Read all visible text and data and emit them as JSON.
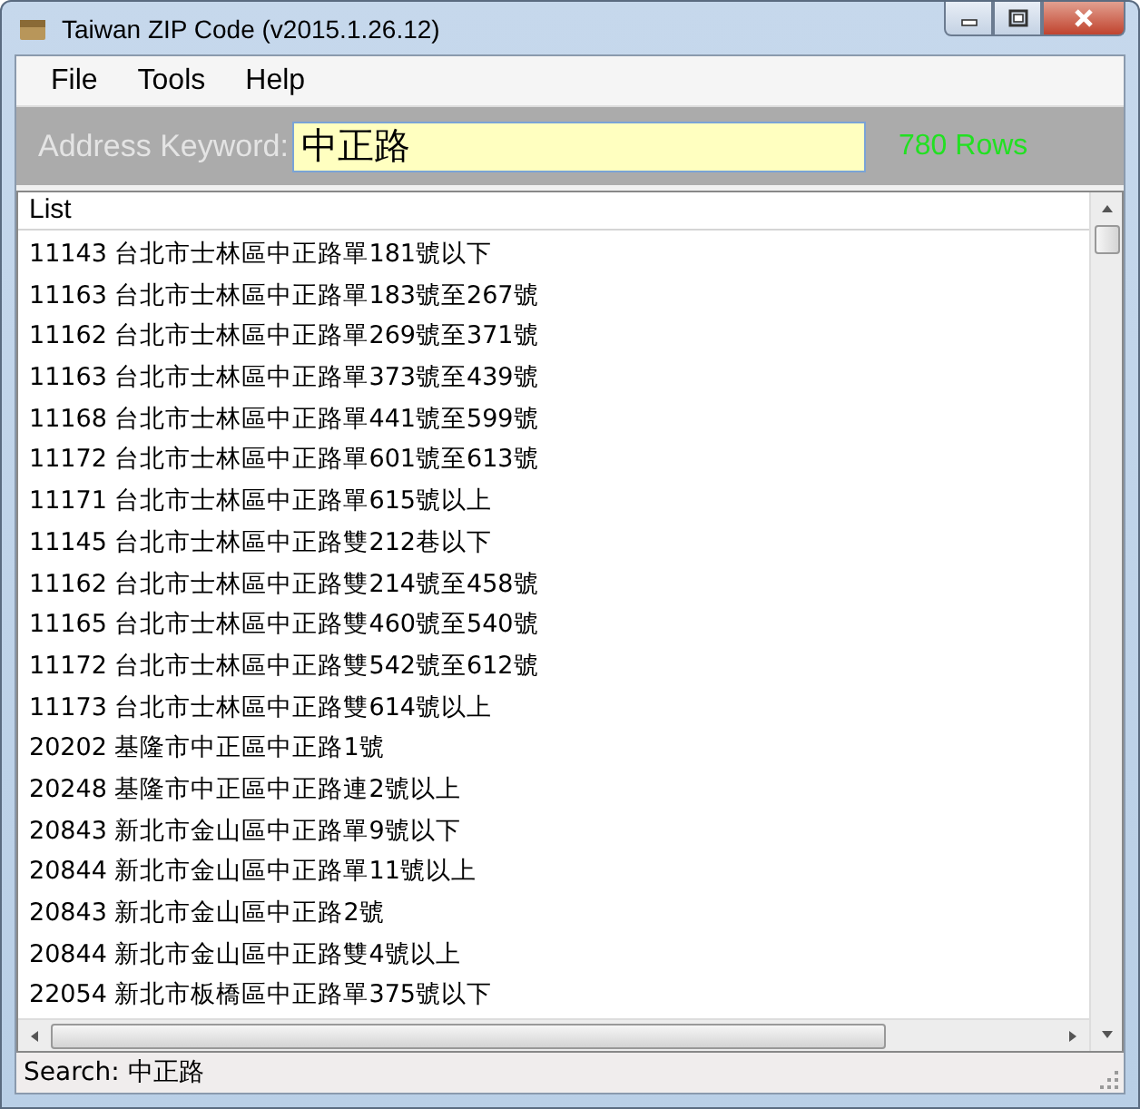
{
  "window": {
    "title": "Taiwan ZIP Code (v2015.1.26.12)"
  },
  "menu": [
    {
      "label": "File"
    },
    {
      "label": "Tools"
    },
    {
      "label": "Help"
    }
  ],
  "search_bar": {
    "label": "Address Keyword:",
    "value": "中正路",
    "row_count": "780 Rows"
  },
  "list": {
    "header": "List",
    "rows": [
      {
        "zip": "11143",
        "address": "台北市士林區中正路單181號以下"
      },
      {
        "zip": "11163",
        "address": "台北市士林區中正路單183號至267號"
      },
      {
        "zip": "11162",
        "address": "台北市士林區中正路單269號至371號"
      },
      {
        "zip": "11163",
        "address": "台北市士林區中正路單373號至439號"
      },
      {
        "zip": "11168",
        "address": "台北市士林區中正路單441號至599號"
      },
      {
        "zip": "11172",
        "address": "台北市士林區中正路單601號至613號"
      },
      {
        "zip": "11171",
        "address": "台北市士林區中正路單615號以上"
      },
      {
        "zip": "11145",
        "address": "台北市士林區中正路雙212巷以下"
      },
      {
        "zip": "11162",
        "address": "台北市士林區中正路雙214號至458號"
      },
      {
        "zip": "11165",
        "address": "台北市士林區中正路雙460號至540號"
      },
      {
        "zip": "11172",
        "address": "台北市士林區中正路雙542號至612號"
      },
      {
        "zip": "11173",
        "address": "台北市士林區中正路雙614號以上"
      },
      {
        "zip": "20202",
        "address": "基隆市中正區中正路1號"
      },
      {
        "zip": "20248",
        "address": "基隆市中正區中正路連2號以上"
      },
      {
        "zip": "20843",
        "address": "新北市金山區中正路單9號以下"
      },
      {
        "zip": "20844",
        "address": "新北市金山區中正路單11號以上"
      },
      {
        "zip": "20843",
        "address": "新北市金山區中正路2號"
      },
      {
        "zip": "20844",
        "address": "新北市金山區中正路雙4號以上"
      },
      {
        "zip": "22054",
        "address": "新北市板橋區中正路單375號以下"
      }
    ]
  },
  "status_bar": {
    "text": "Search: 中正路"
  }
}
